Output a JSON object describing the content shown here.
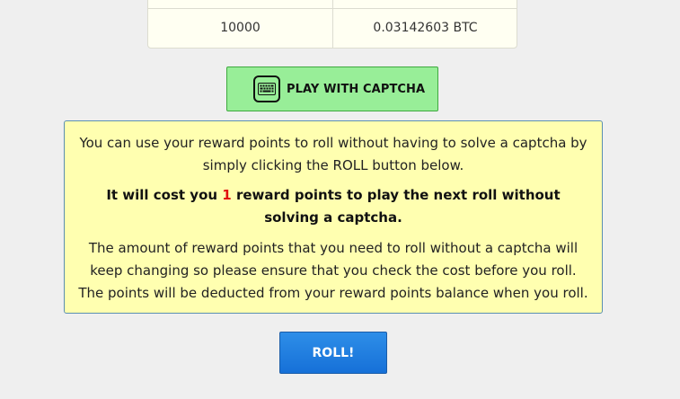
{
  "payout_table": {
    "row": {
      "roll_value": "10000",
      "payout": "0.03142603 BTC"
    }
  },
  "captcha_button": {
    "label": "PLAY WITH CAPTCHA",
    "icon": "keyboard-icon"
  },
  "info_box": {
    "paragraph1": "You can use your reward points to roll without having to solve a captcha by simply clicking the ROLL button below.",
    "cost_prefix": "It will cost you ",
    "cost_value": "1",
    "cost_suffix": " reward points to play the next roll without solving a captcha.",
    "paragraph3": "The amount of reward points that you need to roll without a captcha will keep changing so please ensure that you check the cost before you roll. The points will be deducted from your reward points balance when you roll."
  },
  "roll_button": {
    "label": "ROLL!"
  },
  "colors": {
    "captcha_button_bg": "#98ee98",
    "info_box_bg": "#ffffb0",
    "cost_highlight": "#e01010",
    "roll_button_bg": "#1e7fe0"
  }
}
